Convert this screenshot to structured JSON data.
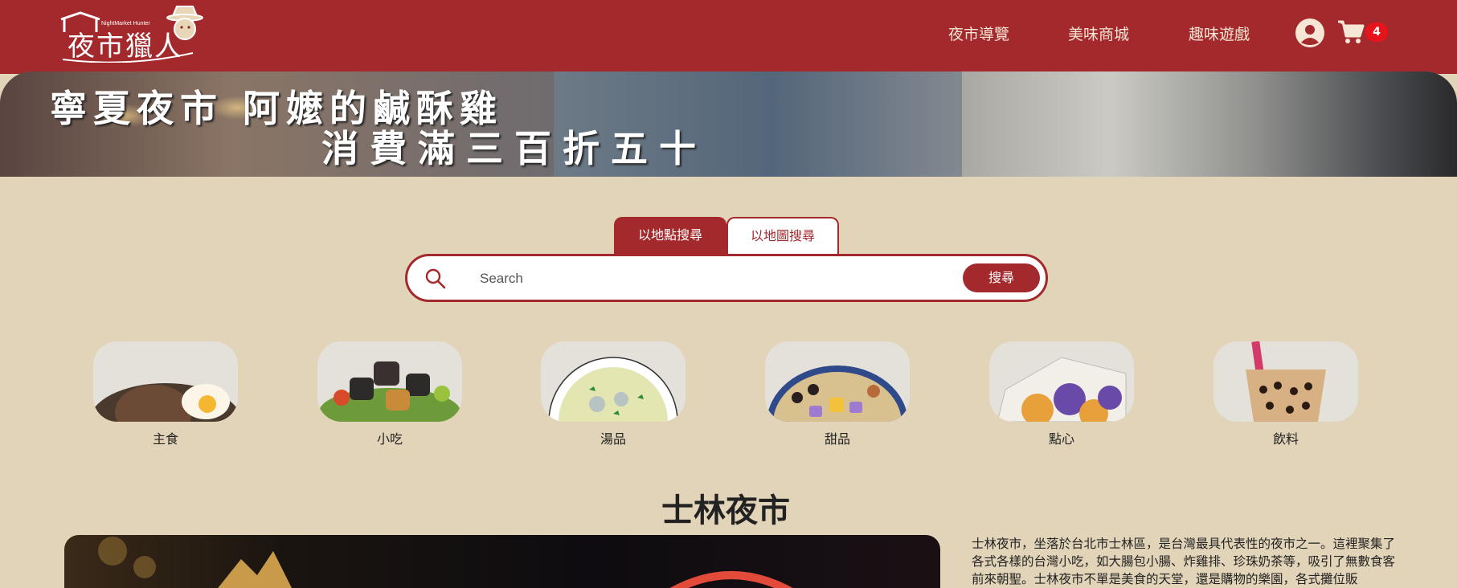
{
  "header": {
    "logo_subtitle": "NightMarket Hunter",
    "logo_title": "夜市獵人",
    "nav": [
      "夜市導覽",
      "美味商城",
      "趣味遊戲"
    ],
    "cart_count": "4",
    "icons": [
      "user-icon",
      "cart-icon"
    ],
    "colors": {
      "brand": "#a3292c",
      "badge": "#e8141b"
    }
  },
  "banner": {
    "line1": "寧夏夜市 阿嬤的鹹酥雞",
    "line2": "消費滿三百折五十"
  },
  "search": {
    "tabs": [
      "以地點搜尋",
      "以地圖搜尋"
    ],
    "active_tab": "以地點搜尋",
    "placeholder": "Search",
    "button": "搜尋"
  },
  "categories": [
    {
      "label": "主食"
    },
    {
      "label": "小吃"
    },
    {
      "label": "湯品"
    },
    {
      "label": "甜品"
    },
    {
      "label": "點心"
    },
    {
      "label": "飲料"
    }
  ],
  "featured": {
    "title": "士林夜市",
    "description": "士林夜市，坐落於台北市士林區，是台灣最具代表性的夜市之一。這裡聚集了各式各樣的台灣小吃，如大腸包小腸、炸雞排、珍珠奶茶等，吸引了無數食客前來朝聖。士林夜市不單是美食的天堂，還是購物的樂園，各式攤位販"
  }
}
